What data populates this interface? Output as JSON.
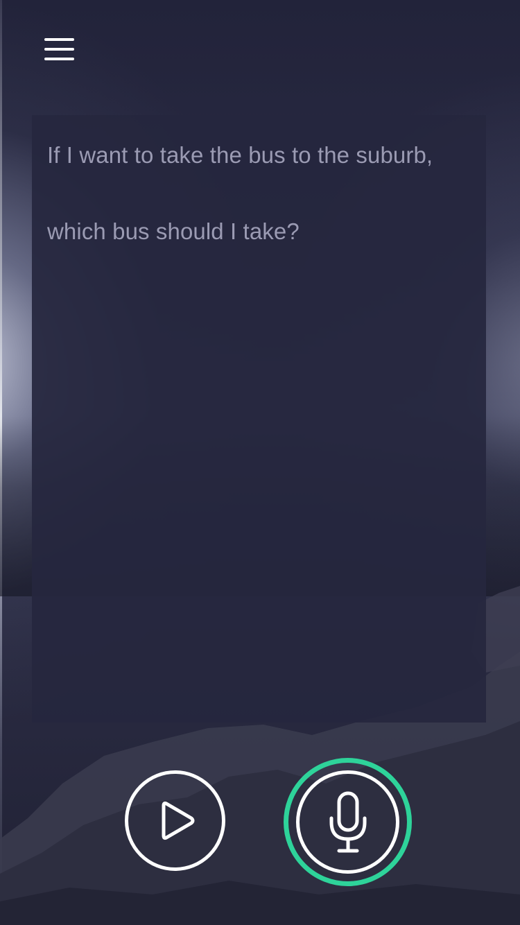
{
  "transcript": {
    "lines": [
      "If I want to take the bus to the suburb,",
      "which bus should I take?"
    ]
  },
  "icons": {
    "menu": "hamburger-menu-icon",
    "play": "play-icon",
    "microphone": "microphone-icon"
  },
  "colors": {
    "background": "#22233a",
    "card": "#26273e",
    "text": "#9b9bb3",
    "accent": "#2ed39a",
    "icon": "#ffffff"
  }
}
